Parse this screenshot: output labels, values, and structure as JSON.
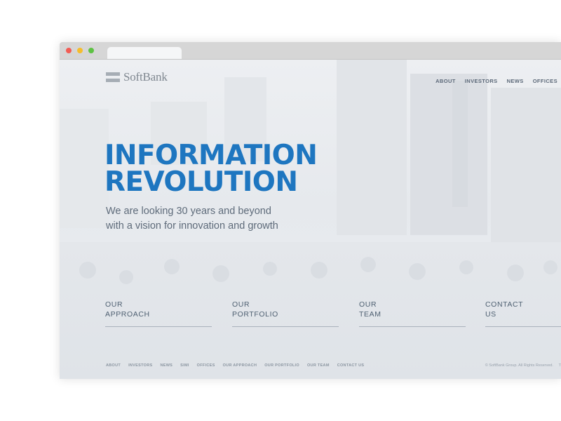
{
  "brand": {
    "name": "SoftBank"
  },
  "nav": {
    "items": [
      {
        "label": "ABOUT"
      },
      {
        "label": "INVESTORS"
      },
      {
        "label": "NEWS"
      },
      {
        "label": "OFFICES"
      }
    ]
  },
  "hero": {
    "title_line1": "INFORMATION",
    "title_line2": "REVOLUTION",
    "subtitle_line1": "We are looking 30 years and beyond",
    "subtitle_line2": "with a vision for innovation and growth"
  },
  "sections": [
    {
      "label": "OUR\nAPPROACH"
    },
    {
      "label": "OUR\nPORTFOLIO"
    },
    {
      "label": "OUR\nTEAM"
    },
    {
      "label": "CONTACT\nUS"
    }
  ],
  "footer": {
    "links": [
      {
        "label": "ABOUT"
      },
      {
        "label": "INVESTORS"
      },
      {
        "label": "NEWS"
      },
      {
        "label": "SIMI"
      },
      {
        "label": "OFFICES"
      },
      {
        "label": "OUR APPROACH"
      },
      {
        "label": "OUR PORTFOLIO"
      },
      {
        "label": "OUR TEAM"
      },
      {
        "label": "CONTACT US"
      }
    ],
    "copyright": "© SoftBank Group. All Rights Reserved.",
    "copyright_tail": "T"
  },
  "colors": {
    "accent": "#1e76c0",
    "text_muted": "#5e6b7a",
    "traffic_red": "#f25c54",
    "traffic_yellow": "#f5bd2c",
    "traffic_green": "#5dc243"
  }
}
